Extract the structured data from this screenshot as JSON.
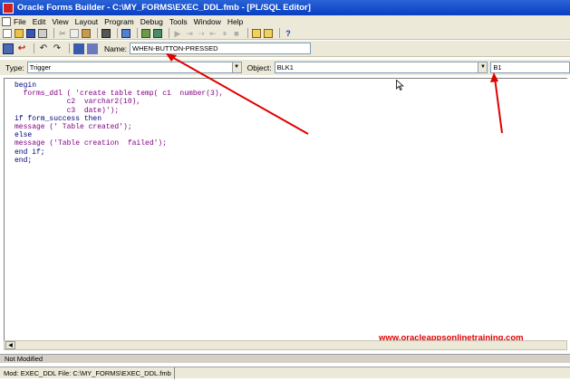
{
  "window": {
    "title": "Oracle Forms Builder - C:\\MY_FORMS\\EXEC_DDL.fmb - [PL/SQL Editor]"
  },
  "menu": [
    "File",
    "Edit",
    "View",
    "Layout",
    "Program",
    "Debug",
    "Tools",
    "Window",
    "Help"
  ],
  "editor_toolbar": {
    "name_label": "Name:",
    "name_value": "WHEN-BUTTON-PRESSED"
  },
  "context": {
    "type_label": "Type:",
    "type_value": "Trigger",
    "object_label": "Object:",
    "object_value": "BLK1",
    "item_value": "B1"
  },
  "code": [
    {
      "text": "begin",
      "style": "kw"
    },
    {
      "text": "  forms_ddl ( 'create table temp( c1  number(3),",
      "style": "str"
    },
    {
      "text": "            c2  varchar2(10),",
      "style": "str"
    },
    {
      "text": "            c3  date)');",
      "style": "str"
    },
    {
      "text": "",
      "style": "kw"
    },
    {
      "text": "if form_success then",
      "style": "kw"
    },
    {
      "text": "message (' Table created');",
      "style": "str"
    },
    {
      "text": "else",
      "style": "kw"
    },
    {
      "text": "message ('Table creation  failed');",
      "style": "str"
    },
    {
      "text": "end if;",
      "style": "kw"
    },
    {
      "text": "end;",
      "style": "kw"
    }
  ],
  "watermark": "www.oracleappsonlinetraining.com",
  "status": {
    "modified": "Not Modified",
    "module": "Mod: EXEC_DDL File: C:\\MY_FORMS\\EXEC_DDL.fmb"
  },
  "colors": {
    "title_bar": "#0a3fc0",
    "keyword": "#000080",
    "string": "#800080",
    "annotation": "#e00000"
  }
}
